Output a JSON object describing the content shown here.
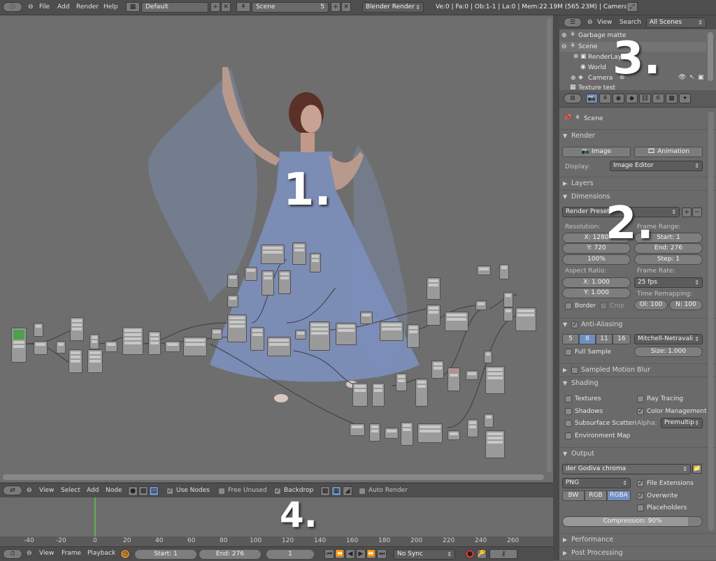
{
  "topbar": {
    "menus": [
      "File",
      "Add",
      "Render",
      "Help"
    ],
    "layout": "Default",
    "scene": "Scene",
    "scene_users": "5",
    "engine": "Blender Render",
    "stats": "Ve:0 | Fa:0 | Ob:1-1 | La:0 | Mem:22.19M (565.23M) | Camera"
  },
  "node_header": {
    "menus": [
      "View",
      "Select",
      "Add",
      "Node"
    ],
    "use_nodes": "Use Nodes",
    "free_unused": "Free Unused",
    "backdrop": "Backdrop",
    "auto_render": "Auto Render"
  },
  "timeline": {
    "ticks": [
      "-40",
      "-20",
      "0",
      "20",
      "40",
      "60",
      "80",
      "100",
      "120",
      "140",
      "160",
      "180",
      "200",
      "220",
      "240",
      "260"
    ],
    "menus": [
      "View",
      "Frame",
      "Playback"
    ],
    "start": "Start: 1",
    "end": "End: 276",
    "current": "1",
    "sync": "No Sync"
  },
  "outliner": {
    "menus": [
      "View",
      "Search"
    ],
    "filter": "All Scenes",
    "items": [
      "Garbage matte",
      "Scene",
      "RenderLayers",
      "World",
      "Camera",
      "Texture test"
    ]
  },
  "properties": {
    "breadcrumb": "Scene",
    "render": {
      "title": "Render",
      "image_btn": "Image",
      "animation_btn": "Animation",
      "display_label": "Display:",
      "display_value": "Image Editor"
    },
    "layers": "Layers",
    "dimensions": {
      "title": "Dimensions",
      "presets": "Render Presets",
      "resolution_label": "Resolution:",
      "res_x": "X: 1280",
      "res_y": "Y: 720",
      "res_pct": "100%",
      "frame_range_label": "Frame Range:",
      "start": "Start: 1",
      "end": "End: 276",
      "step": "Step: 1",
      "aspect_label": "Aspect Ratio:",
      "aspect_x": "X: 1.000",
      "aspect_y": "Y: 1.000",
      "frame_rate_label": "Frame Rate:",
      "fps": "25 fps",
      "time_remap_label": "Time Remapping:",
      "remap_old": "Ol: 100",
      "remap_new": "N: 100",
      "border": "Border",
      "crop": "Crop"
    },
    "antialiasing": {
      "title": "Anti-Aliasing",
      "samples": [
        "5",
        "8",
        "11",
        "16"
      ],
      "filter": "Mitchell-Netravali",
      "full_sample": "Full Sample",
      "size": "Size: 1.000"
    },
    "motion_blur": "Sampled Motion Blur",
    "shading": {
      "title": "Shading",
      "textures": "Textures",
      "ray_tracing": "Ray Tracing",
      "shadows": "Shadows",
      "color_management": "Color Management",
      "sss": "Subsurface Scatteri",
      "alpha_label": "Alpha:",
      "alpha_value": "Premultip",
      "env_map": "Environment Map"
    },
    "output": {
      "title": "Output",
      "path": "der Godiva chroma key\\b_godiva_ck_####",
      "format": "PNG",
      "file_extensions": "File Extensions",
      "bw": "BW",
      "rgb": "RGB",
      "rgba": "RGBA",
      "overwrite": "Overwrite",
      "placeholders": "Placeholders",
      "compression": "Compression: 90%",
      "compression_value": 0.9
    },
    "performance": "Performance",
    "post_processing": "Post Processing"
  },
  "overlays": {
    "label1": "1.",
    "label2": "2.",
    "label3": "3.",
    "label4": "4."
  }
}
